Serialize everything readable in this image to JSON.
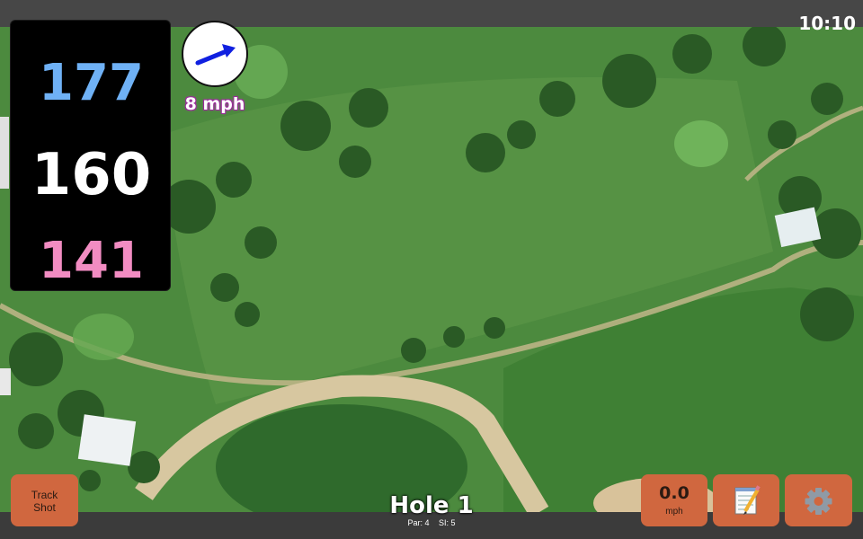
{
  "status_bar": {
    "time": "10:10"
  },
  "distances": {
    "back": "177",
    "center": "160",
    "front": "141"
  },
  "wind": {
    "speed": "8 mph",
    "icon": "wind-arrow-icon"
  },
  "buttons": {
    "track_shot_line1": "Track",
    "track_shot_line2": "Shot",
    "speed_value": "0.0",
    "speed_unit": "mph",
    "notes_icon": "notepad-icon",
    "settings_icon": "gear-icon"
  },
  "hole": {
    "title": "Hole 1",
    "par": "Par: 4",
    "si": "SI: 5"
  },
  "colors": {
    "back": "#6fb1f5",
    "center": "#ffffff",
    "front": "#f28cc2",
    "button": "#d0673f",
    "wind_arrow": "#1020e0"
  }
}
